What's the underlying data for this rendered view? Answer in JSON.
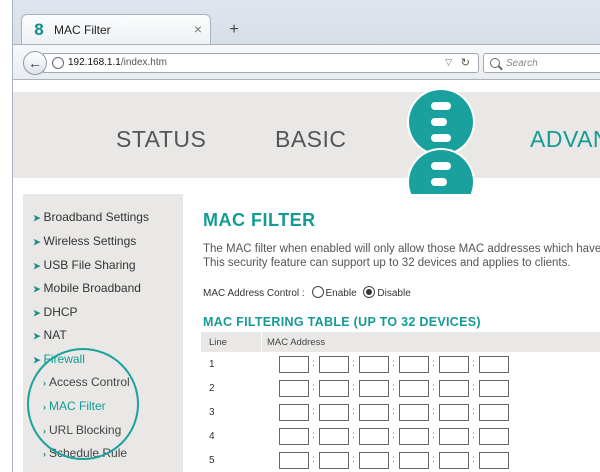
{
  "browser": {
    "tab_title": "MAC Filter",
    "tab_close": "×",
    "new_tab": "+",
    "url_domain": "192.168.1.1",
    "url_path": "/index.htm",
    "search_placeholder": "Search"
  },
  "topnav": {
    "items": [
      "STATUS",
      "BASIC",
      "ADVAN"
    ]
  },
  "sidebar": {
    "items": [
      {
        "label": "Broadband Settings"
      },
      {
        "label": "Wireless Settings"
      },
      {
        "label": "USB File Sharing"
      },
      {
        "label": "Mobile Broadband"
      },
      {
        "label": "DHCP"
      },
      {
        "label": "NAT"
      },
      {
        "label": "Firewall"
      }
    ],
    "sub_items": [
      {
        "label": "Access Control"
      },
      {
        "label": "MAC Filter"
      },
      {
        "label": "URL Blocking"
      },
      {
        "label": "Schedule Rule"
      }
    ],
    "active": "MAC Filter"
  },
  "content": {
    "title": "MAC FILTER",
    "desc_line1": "The MAC filter when enabled will only allow those MAC addresses which have",
    "desc_line2": "This security feature can support up to 32 devices and applies to clients.",
    "control_label": "MAC Address Control :",
    "enable_label": "Enable",
    "disable_label": "Disable",
    "selected": "Disable",
    "table_title": "MAC FILTERING TABLE (UP TO 32 DEVICES)",
    "col_line": "Line",
    "col_mac": "MAC Address",
    "rows": [
      "1",
      "2",
      "3",
      "4",
      "5"
    ]
  },
  "colors": {
    "brand_teal": "#169a95",
    "panel_grey": "#e9e8e6"
  }
}
